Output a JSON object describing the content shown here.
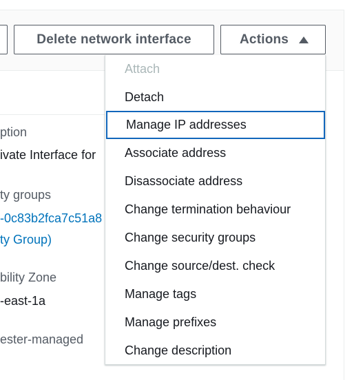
{
  "toolbar": {
    "delete_label": "Delete network interface",
    "actions_label": "Actions",
    "actions_icon": "caret-up-icon"
  },
  "details": {
    "description": {
      "label": "ption",
      "value": "ivate Interface for"
    },
    "security_groups": {
      "label": "ty groups",
      "link_line1": "-0c83b2fca7c51a8",
      "link_line2": "ty Group)"
    },
    "availability_zone": {
      "label": "bility Zone",
      "value": "-east-1a"
    },
    "requester_managed": {
      "label": "ester-managed"
    }
  },
  "actions_menu": {
    "items": [
      {
        "label": "Attach",
        "state": "disabled"
      },
      {
        "label": "Detach",
        "state": "enabled"
      },
      {
        "label": "Manage IP addresses",
        "state": "highlighted"
      },
      {
        "label": "Associate address",
        "state": "enabled"
      },
      {
        "label": "Disassociate address",
        "state": "enabled"
      },
      {
        "label": "Change termination behaviour",
        "state": "enabled"
      },
      {
        "label": "Change security groups",
        "state": "enabled"
      },
      {
        "label": "Change source/dest. check",
        "state": "enabled"
      },
      {
        "label": "Manage tags",
        "state": "enabled"
      },
      {
        "label": "Manage prefixes",
        "state": "enabled"
      },
      {
        "label": "Change description",
        "state": "enabled"
      }
    ]
  },
  "colors": {
    "link": "#0073bb",
    "focus_ring": "#1166bb",
    "button_border": "#545b64",
    "disabled_text": "#aab7b8"
  }
}
